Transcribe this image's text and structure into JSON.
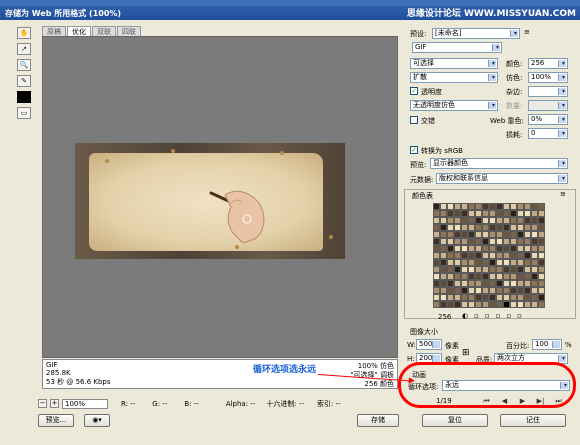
{
  "window": {
    "title": "存储为 Web 所用格式 (100%)",
    "watermark": "思缘设计论坛 WWW.MISSYUAN.COM"
  },
  "view_tabs": [
    "原稿",
    "优化",
    "双联",
    "四联"
  ],
  "tools": [
    "hand-icon",
    "slice-select-icon",
    "zoom-icon",
    "eyedropper-icon"
  ],
  "info": {
    "format": "GIF",
    "size": "285.8K",
    "time": "53 秒 @ 56.6 Kbps",
    "dither": "100% 仿色",
    "palette": "\"可选择\" 调板",
    "colors": "256 颜色"
  },
  "statusbar": {
    "zoom": "100%",
    "r": "R: --",
    "g": "G: --",
    "b": "B: --",
    "alpha": "Alpha: --",
    "hex": "十六进制: --",
    "index": "索引: --"
  },
  "buttons": {
    "preview": "预览...",
    "save": "存储",
    "reset": "复位",
    "remember": "记住"
  },
  "settings": {
    "preset_label": "预设:",
    "preset": "[未命名]",
    "format": "GIF",
    "palette": "可选择",
    "colors_label": "颜色:",
    "colors": "256",
    "dither_algo": "扩散",
    "dither_label": "仿色:",
    "dither": "100%",
    "transparency_label": "透明度",
    "transparency_checked": true,
    "matte_label": "杂边:",
    "matte_dither": "无透明度仿色",
    "amount_label": "数量:",
    "interlace_label": "交错",
    "interlace_checked": false,
    "web_snap_label": "Web 靠色:",
    "web_snap": "0%",
    "lossy_label": "损耗:",
    "lossy": "0",
    "convert_srgb_label": "转换为 sRGB",
    "convert_srgb_checked": true,
    "preview_label": "预览:",
    "preview_value": "显示器颜色",
    "metadata_label": "元数据:",
    "metadata_value": "版权和联系信息"
  },
  "color_table": {
    "title": "颜色表",
    "count": "256"
  },
  "image_size": {
    "title": "图像大小",
    "w_label": "W:",
    "w": "500",
    "h_label": "H:",
    "h": "200",
    "unit": "像素",
    "percent_label": "百分比:",
    "percent": "100",
    "percent_unit": "%",
    "quality_label": "品质:",
    "quality": "两次立方"
  },
  "animation": {
    "title": "动画",
    "loop_label": "循环选项:",
    "loop": "永远",
    "frame": "1/19"
  },
  "annotation": {
    "text": "循环选项选永远"
  },
  "colors": {
    "annotation_red": "#ff0000",
    "annotation_blue": "#1b5fd6",
    "title_blue": "#1f4f9c"
  }
}
